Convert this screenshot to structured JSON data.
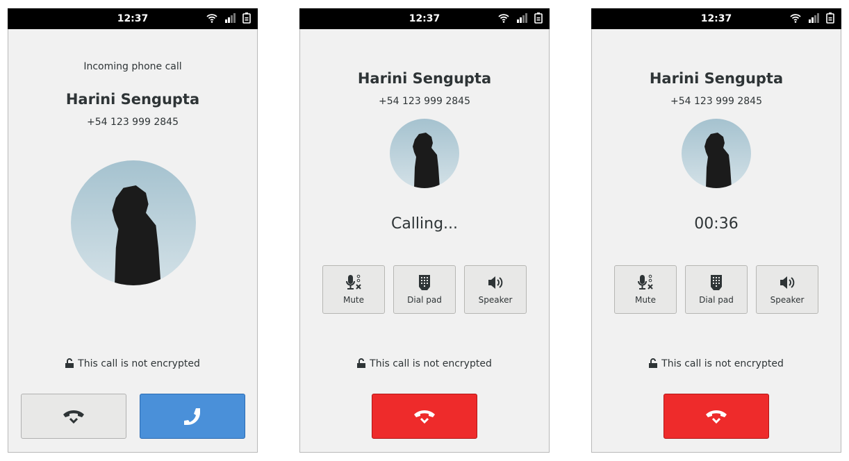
{
  "status_bar": {
    "time": "12:37"
  },
  "contact": {
    "name": "Harini Sengupta",
    "number": "+54 123 999 2845"
  },
  "screen_incoming": {
    "heading": "Incoming phone call",
    "encryption": "This call is not encrypted"
  },
  "screen_calling": {
    "state": "Calling...",
    "encryption": "This call is not encrypted"
  },
  "screen_active": {
    "duration": "00:36",
    "encryption": "This call is not encrypted"
  },
  "controls": {
    "mute": "Mute",
    "dialpad": "Dial pad",
    "speaker": "Speaker"
  },
  "colors": {
    "accept": "#4a90d9",
    "hangup": "#ee2b2b"
  }
}
